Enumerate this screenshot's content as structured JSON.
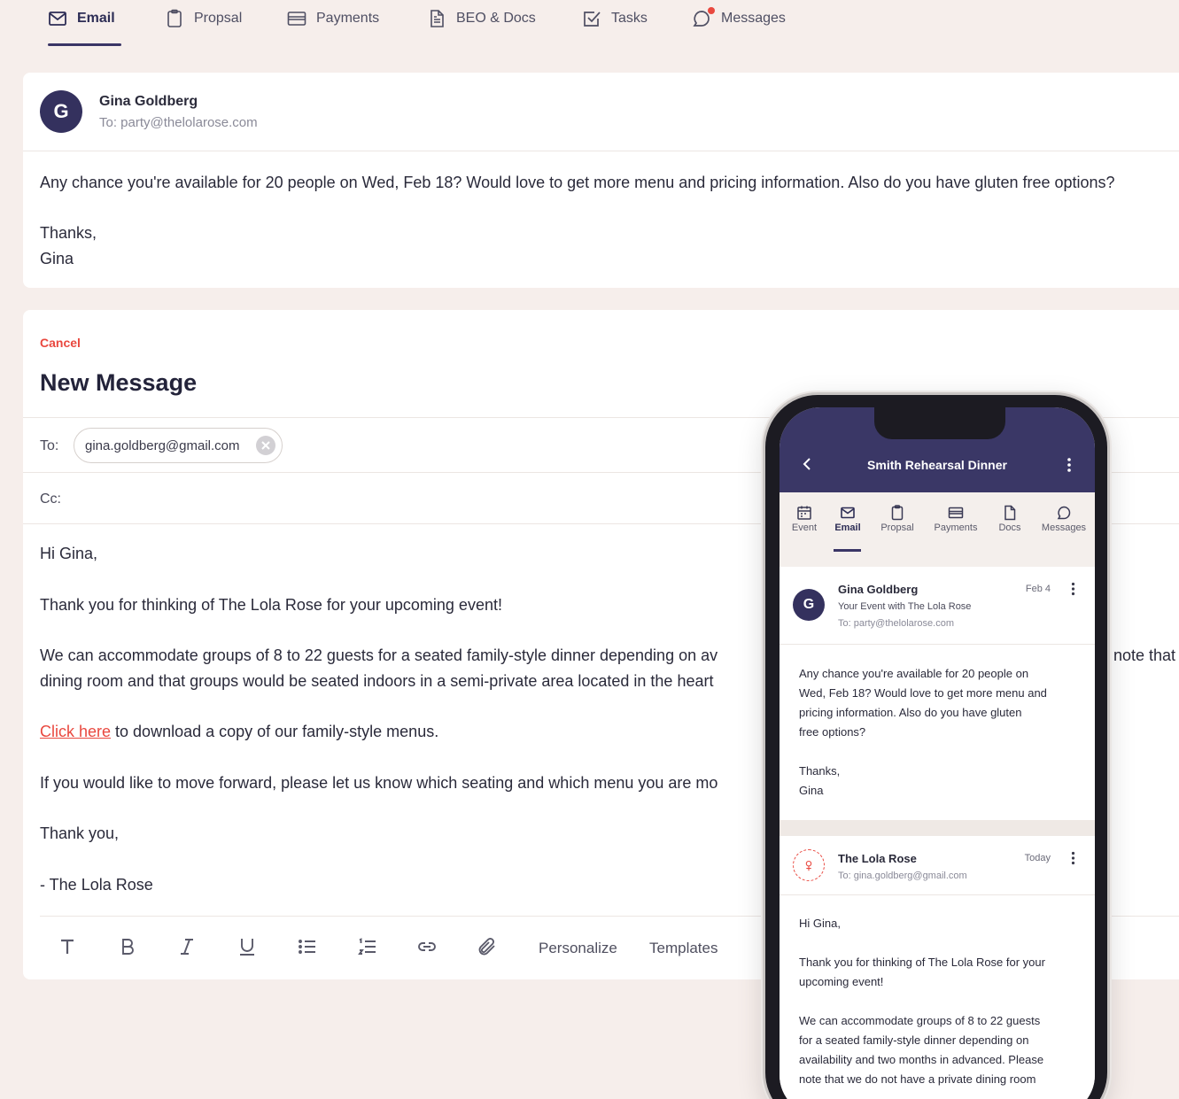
{
  "tabs": [
    {
      "label": "Email",
      "icon": "mail-icon",
      "active": true
    },
    {
      "label": "Propsal",
      "icon": "clipboard-icon"
    },
    {
      "label": "Payments",
      "icon": "card-icon"
    },
    {
      "label": "BEO & Docs",
      "icon": "document-icon"
    },
    {
      "label": "Tasks",
      "icon": "checkbox-icon"
    },
    {
      "label": "Messages",
      "icon": "chat-icon"
    }
  ],
  "received_email": {
    "avatar_initial": "G",
    "sender_name": "Gina Goldberg",
    "to_line": "To: party@thelolarose.com",
    "body_line": "Any chance you're available for 20 people on Wed, Feb 18? Would love to get more menu and pricing information. Also do you have gluten free options?",
    "thanks": "Thanks,",
    "signoff": "Gina"
  },
  "compose": {
    "cancel_label": "Cancel",
    "title": "New Message",
    "to_label": "To:",
    "to_chip": "gina.goldberg@gmail.com",
    "cc_label": "Cc:",
    "greeting": "Hi Gina,",
    "line1": "Thank you for thinking of The Lola Rose for your upcoming event!",
    "line2a": "We can accommodate groups of 8 to 22 guests for a seated family-style dinner depending on av",
    "line2a_tail": "note that",
    "line2b": "dining room and that groups would be seated indoors in a semi-private area located in the heart",
    "link_text": "Click here",
    "line3_rest": " to download a copy of our family-style menus.",
    "line4": "If you would like to move forward, please let us know which seating and which menu you are mo",
    "closing": "Thank you,",
    "signature": "- The Lola Rose",
    "toolbar": {
      "personalize": "Personalize",
      "templates": "Templates"
    }
  },
  "phone": {
    "header_title": "Smith Rehearsal Dinner",
    "tabs": [
      "Event",
      "Email",
      "Propsal",
      "Payments",
      "Docs",
      "Messages"
    ],
    "email1": {
      "avatar_initial": "G",
      "name": "Gina Goldberg",
      "date": "Feb 4",
      "subject": "Your Event with The Lola Rose",
      "to": "To: party@thelolarose.com",
      "body": [
        "Any chance you're available for 20 people on",
        "Wed, Feb 18? Would love to get more menu and",
        "pricing information. Also do you have gluten",
        "free options?"
      ],
      "thanks": "Thanks,",
      "signoff": "Gina"
    },
    "email2": {
      "name": "The Lola Rose",
      "date": "Today",
      "to": "To: gina.goldberg@gmail.com",
      "greeting": "Hi Gina,",
      "p1": [
        "Thank you for thinking of The Lola Rose for your",
        "upcoming event!"
      ],
      "p2": [
        "We can accommodate groups of 8 to 22 guests",
        "for a seated family-style dinner depending on",
        "availability and two months in advanced. Please",
        "note that we do not have a private dining room"
      ]
    }
  }
}
